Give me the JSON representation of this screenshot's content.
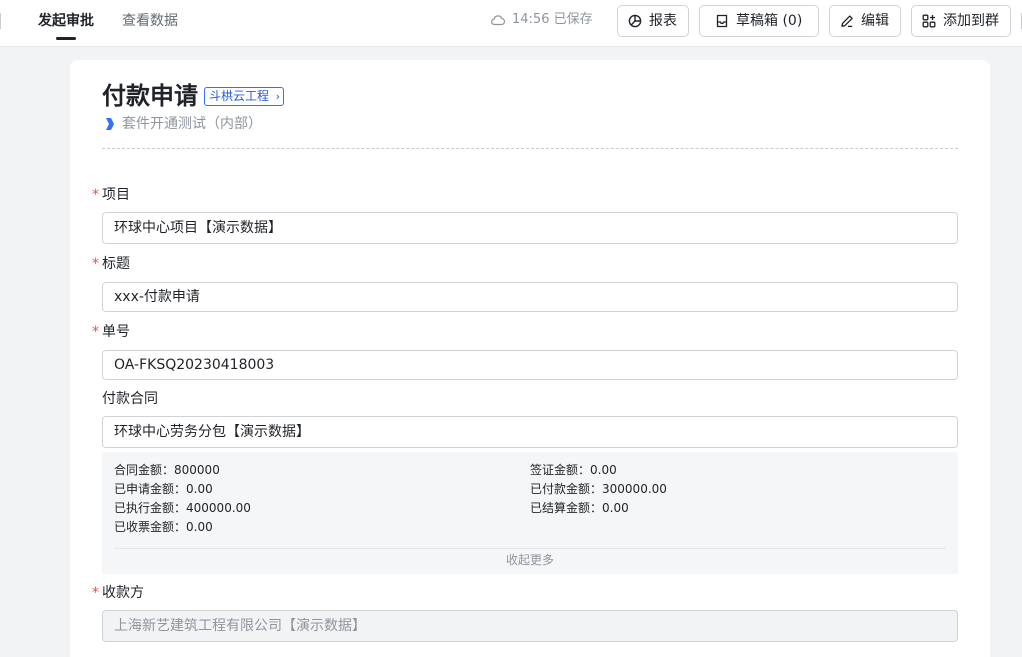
{
  "header": {
    "tabs": [
      {
        "label": "发起审批"
      },
      {
        "label": "查看数据"
      }
    ],
    "saved_text": "14:56 已保存",
    "buttons": {
      "report": "报表",
      "draft": "草稿箱 (0)",
      "edit": "编辑",
      "add_group": "添加到群"
    }
  },
  "form": {
    "title": "付款申请",
    "brand_tag": "斗栱云工程",
    "brand_chevron": "›",
    "suite": "套件开通测试（内部）",
    "required_mark": "*",
    "fields": {
      "project": {
        "label": "项目",
        "value": "环球中心项目【演示数据】"
      },
      "title": {
        "label": "标题",
        "value": "xxx-付款申请"
      },
      "number": {
        "label": "单号",
        "value": "OA-FKSQ20230418003"
      },
      "contract": {
        "label": "付款合同",
        "value": "环球中心劳务分包【演示数据】"
      },
      "payee": {
        "label": "收款方",
        "value": "上海新艺建筑工程有限公司【演示数据】"
      }
    },
    "contract_info": {
      "items": [
        {
          "label": "合同金额：",
          "value": "800000"
        },
        {
          "label": "签证金额：",
          "value": "0.00"
        },
        {
          "label": "已申请金额：",
          "value": "0.00"
        },
        {
          "label": "已付款金额：",
          "value": "300000.00"
        },
        {
          "label": "已执行金额：",
          "value": "400000.00"
        },
        {
          "label": "已结算金额：",
          "value": "0.00"
        },
        {
          "label": "已收票金额：",
          "value": "0.00"
        }
      ],
      "collapse_label": "收起更多"
    }
  },
  "colors": {
    "accent": "#3370ff",
    "required": "#f54a45",
    "suite_icon": "#3370ff"
  }
}
